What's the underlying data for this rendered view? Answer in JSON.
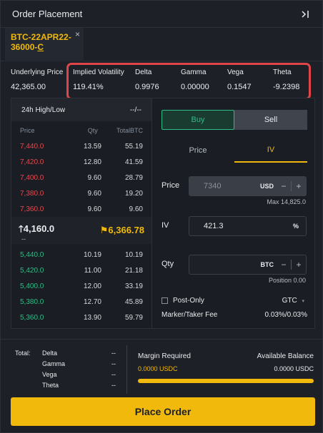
{
  "header": {
    "title": "Order Placement",
    "collapse_icon": "collapse-right-icon"
  },
  "instrument_tab": {
    "line1": "BTC-22APR22-",
    "line2": "36000-",
    "line3": "C",
    "close": "×"
  },
  "stats": [
    {
      "label": "Underlying Price",
      "value": "42,365.00"
    },
    {
      "label": "Implied Volatility",
      "value": "119.41%"
    },
    {
      "label": "Delta",
      "value": "0.9976"
    },
    {
      "label": "Gamma",
      "value": "0.00000"
    },
    {
      "label": "Vega",
      "value": "0.1547"
    },
    {
      "label": "Theta",
      "value": "-9.2398"
    }
  ],
  "orderbook": {
    "high_low_label": "24h High/Low",
    "high_low_value": "--/--",
    "columns": [
      "Price",
      "Qty",
      "TotalBTC"
    ],
    "asks": [
      {
        "price": "7,440.0",
        "qty": "13.59",
        "total": "55.19"
      },
      {
        "price": "7,420.0",
        "qty": "12.80",
        "total": "41.59"
      },
      {
        "price": "7,400.0",
        "qty": "9.60",
        "total": "28.79"
      },
      {
        "price": "7,380.0",
        "qty": "9.60",
        "total": "19.20"
      },
      {
        "price": "7,360.0",
        "qty": "9.60",
        "total": "9.60"
      }
    ],
    "mid": {
      "left": "4,160.0",
      "right": "6,366.78",
      "sub": "--"
    },
    "bids": [
      {
        "price": "5,440.0",
        "qty": "10.19",
        "total": "10.19"
      },
      {
        "price": "5,420.0",
        "qty": "11.00",
        "total": "21.18"
      },
      {
        "price": "5,400.0",
        "qty": "12.00",
        "total": "33.19"
      },
      {
        "price": "5,380.0",
        "qty": "12.70",
        "total": "45.89"
      },
      {
        "price": "5,360.0",
        "qty": "13.90",
        "total": "59.79"
      }
    ]
  },
  "form": {
    "buy_label": "Buy",
    "sell_label": "Sell",
    "mode_price": "Price",
    "mode_iv": "IV",
    "price_label": "Price",
    "price_value": "7340",
    "price_unit": "USD",
    "price_max": "Max 14,825.0",
    "iv_label": "IV",
    "iv_value": "421.3",
    "iv_unit": "%",
    "qty_label": "Qty",
    "qty_unit": "BTC",
    "position": "Position 0.00",
    "post_only": "Post-Only",
    "tif": "GTC",
    "fee_label": "Marker/Taker Fee",
    "fee_value": "0.03%/0.03%"
  },
  "footer": {
    "total_label": "Total:",
    "greeks": [
      {
        "name": "Delta",
        "value": "--"
      },
      {
        "name": "Gamma",
        "value": "--"
      },
      {
        "name": "Vega",
        "value": "--"
      },
      {
        "name": "Theta",
        "value": "--"
      }
    ],
    "margin_label": "Margin Required",
    "margin_value": "0.0000 USDC",
    "balance_label": "Available Balance",
    "balance_value": "0.0000 USDC",
    "margin_ratio": 1.0
  },
  "place_order": "Place Order",
  "colors": {
    "accent": "#f0b90b",
    "buy": "#2ebd85",
    "sell": "#e04a51",
    "highlight_box": "#e0454a"
  }
}
